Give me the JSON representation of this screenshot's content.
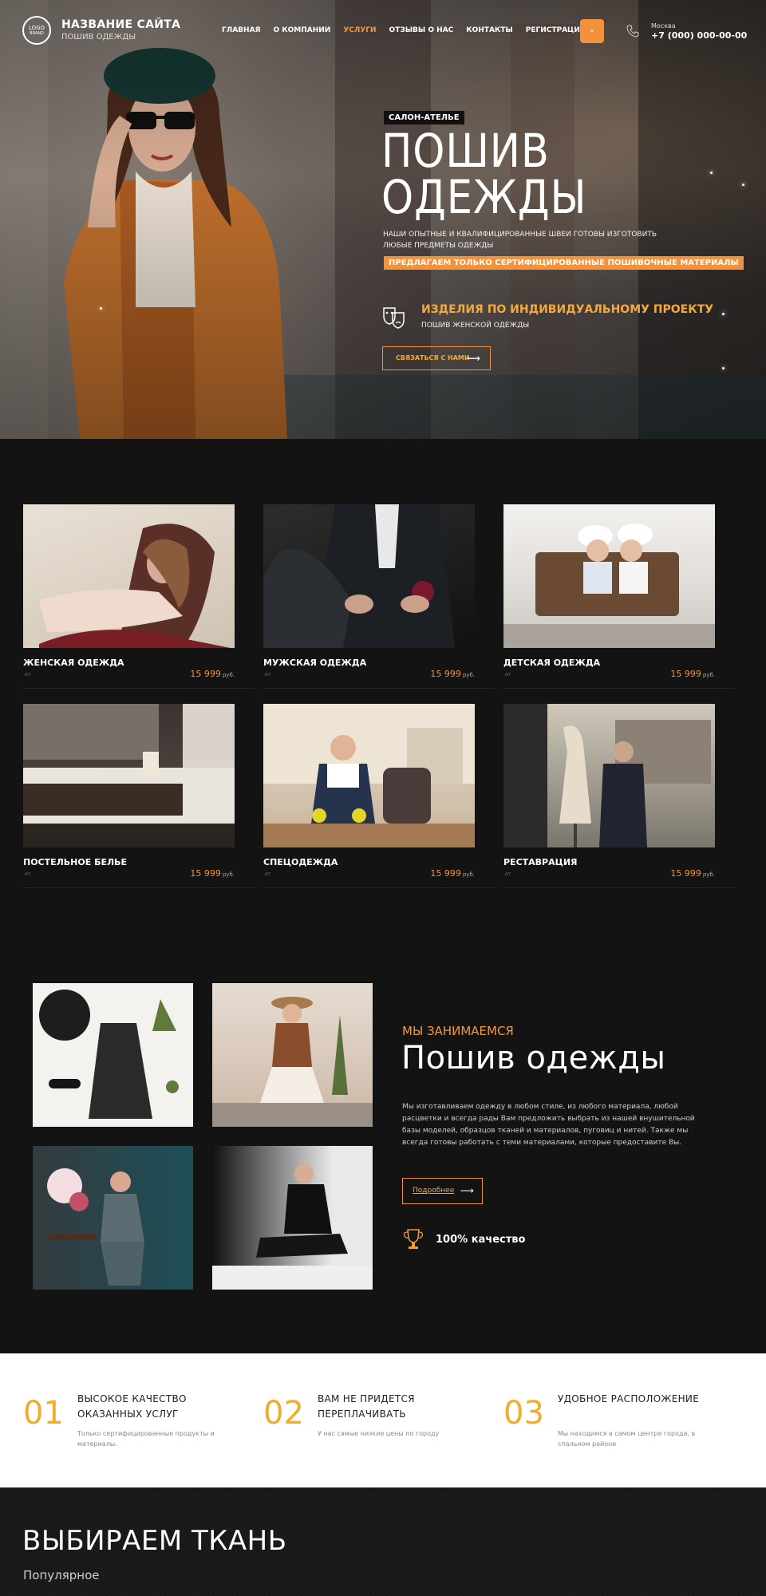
{
  "header": {
    "logo_text": "LOGO",
    "logo_sub": "BRAND",
    "site_title": "НАЗВАНИЕ САЙТА",
    "site_subtitle": "ПОШИВ ОДЕЖДЫ",
    "nav": [
      "ГЛАВНАЯ",
      "О КОМПАНИИ",
      "УСЛУГИ",
      "ОТЗЫВЫ О НАС",
      "КОНТАКТЫ",
      "РЕГИСТРАЦИЯ"
    ],
    "active_nav": "УСЛУГИ",
    "city": "Москва",
    "phone": "+7 (000) 000-00-00"
  },
  "hero": {
    "badge": "САЛОН-АТЕЛЬЕ",
    "title_line1": "ПОШИВ",
    "title_line2": "ОДЕЖДЫ",
    "description": "НАШИ ОПЫТНЫЕ И КВАЛИФИЦИРОВАННЫЕ ШВЕИ ГОТОВЫ ИЗГОТОВИТЬ ЛЮБЫЕ ПРЕДМЕТЫ ОДЕЖДЫ",
    "highlight": "ПРЕДЛАГАЕМ ТОЛЬКО СЕРТИФИЦИРОВАННЫЕ ПОШИВОЧНЫЕ МАТЕРИАЛЫ",
    "project_title": "ИЗДЕЛИЯ ПО ИНДИВИДУАЛЬНОМУ ПРОЕКТУ",
    "project_sub": "ПОШИВ ЖЕНСКОЙ ОДЕЖДЫ",
    "contact_button": "СВЯЗАТЬСЯ С НАМИ"
  },
  "catalog": {
    "currency": "руб.",
    "items": [
      {
        "name": "ЖЕНСКАЯ ОДЕЖДА",
        "price": "15 999",
        "note": "от"
      },
      {
        "name": "МУЖСКАЯ ОДЕЖДА",
        "price": "15 999",
        "note": "от"
      },
      {
        "name": "ДЕТСКАЯ ОДЕЖДА",
        "price": "15 999",
        "note": "от"
      },
      {
        "name": "ПОСТЕЛЬНОЕ БЕЛЬЕ",
        "price": "15 999",
        "note": "от"
      },
      {
        "name": "СПЕЦОДЕЖДА",
        "price": "15 999",
        "note": "от"
      },
      {
        "name": "РЕСТАВРАЦИЯ",
        "price": "15 999",
        "note": "от"
      }
    ]
  },
  "about": {
    "kicker": "МЫ ЗАНИМАЕМСЯ",
    "title": "Пошив одежды",
    "text": "Мы изготавливаем одежду в любом стиле, из любого материала, любой расцветки и всегда рады Вам предложить выбрать из нашей внушительной базы моделей, образцов тканей и материалов, пуговиц и нитей. Также мы всегда готовы работать с теми материалами, которые предоставите Вы.",
    "more_button": "Подробнее",
    "quality": "100% качество"
  },
  "features": [
    {
      "num": "01",
      "title": "ВЫСОКОЕ КАЧЕСТВО ОКАЗАННЫХ УСЛУГ",
      "text": "Только сертифицированные продукты и материалы."
    },
    {
      "num": "02",
      "title": "ВАМ НЕ ПРИДЕТСЯ ПЕРЕПЛАЧИВАТЬ",
      "text": "У нас самые низкие цены по городу"
    },
    {
      "num": "03",
      "title": "УДОБНОЕ РАСПОЛОЖЕНИЕ",
      "text": "Мы находимся в самом центре города, в спальном районе"
    }
  ],
  "fabric": {
    "title": "ВЫБИРАЕМ ТКАНЬ",
    "subtitle": "Популярное"
  },
  "colors": {
    "accent": "#f3923a",
    "dark": "#131313",
    "gold": "#f2ab2b"
  }
}
